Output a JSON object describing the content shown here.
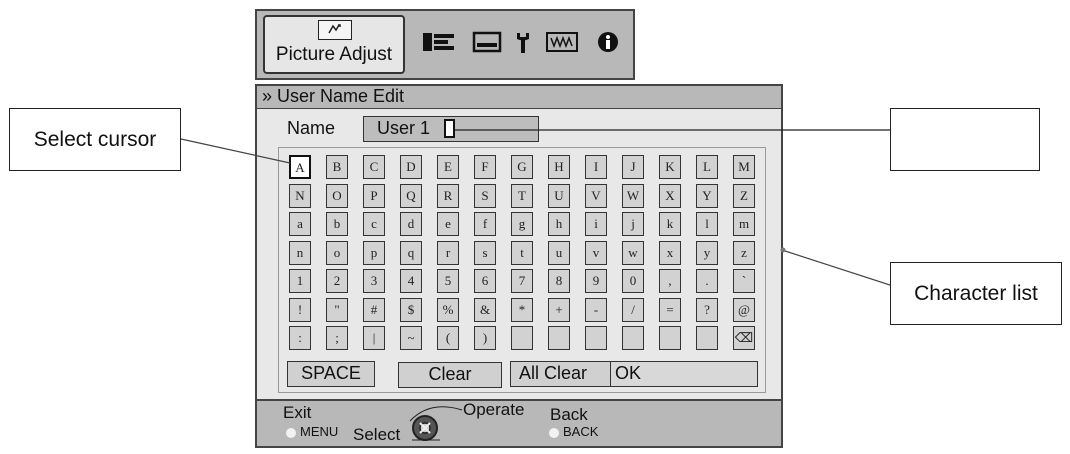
{
  "menu": {
    "active_tab": "Picture Adjust",
    "tab_icons": [
      "picture-icon",
      "setup-icon",
      "display-icon",
      "tools-icon",
      "network-icon",
      "info-icon"
    ]
  },
  "title": "» User Name Edit",
  "name_field": {
    "label": "Name",
    "value": "User 1"
  },
  "characters": {
    "rows": [
      [
        "A",
        "B",
        "C",
        "D",
        "E",
        "F",
        "G",
        "H",
        "I",
        "J",
        "K",
        "L",
        "M"
      ],
      [
        "N",
        "O",
        "P",
        "Q",
        "R",
        "S",
        "T",
        "U",
        "V",
        "W",
        "X",
        "Y",
        "Z"
      ],
      [
        "a",
        "b",
        "c",
        "d",
        "e",
        "f",
        "g",
        "h",
        "i",
        "j",
        "k",
        "l",
        "m"
      ],
      [
        "n",
        "o",
        "p",
        "q",
        "r",
        "s",
        "t",
        "u",
        "v",
        "w",
        "x",
        "y",
        "z"
      ],
      [
        "1",
        "2",
        "3",
        "4",
        "5",
        "6",
        "7",
        "8",
        "9",
        "0",
        ",",
        ".",
        "`"
      ],
      [
        "!",
        "\"",
        "#",
        "$",
        "%",
        "&",
        "*",
        "+",
        "-",
        "/",
        "=",
        "?",
        "@"
      ],
      [
        ":",
        ";",
        "|",
        "~",
        "(",
        ")",
        "",
        "",
        "",
        "",
        "",
        "",
        "⌫"
      ]
    ],
    "selected": "A"
  },
  "buttons": {
    "space": "SPACE",
    "clear": "Clear",
    "all_clear": "All Clear",
    "ok": "OK"
  },
  "footer": {
    "exit": "Exit",
    "exit_key": "MENU",
    "select": "Select",
    "operate": "Operate",
    "back": "Back",
    "back_key": "BACK"
  },
  "callouts": {
    "select_cursor": "Select cursor",
    "character_list": "Character list",
    "name_field": ""
  }
}
